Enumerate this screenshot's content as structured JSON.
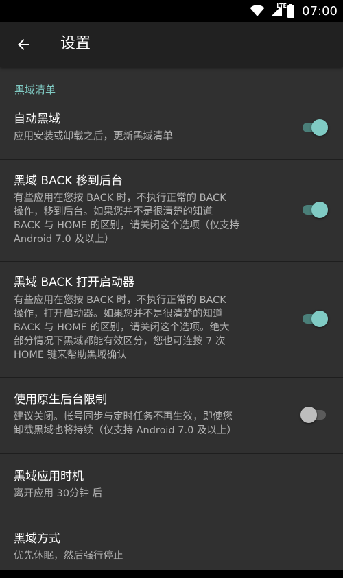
{
  "status_bar": {
    "time": "07:00",
    "network_label": "LTE"
  },
  "app_bar": {
    "title": "设置",
    "back_icon": "arrow-back-icon"
  },
  "section": {
    "header": "黑域清单"
  },
  "preferences": [
    {
      "title": "自动黑域",
      "summary": "应用安装或卸载之后，更新黑域清单",
      "switch": "on"
    },
    {
      "title": "黑域 BACK 移到后台",
      "summary": "有些应用在您按 BACK 时，不执行正常的 BACK\n操作，移到后台。如果您并不是很清楚的知道\nBACK 与 HOME 的区别，请关闭这个选项（仅支持\nAndroid 7.0 及以上）",
      "switch": "on"
    },
    {
      "title": "黑域 BACK 打开启动器",
      "summary": "有些应用在您按 BACK 时，不执行正常的 BACK\n操作，打开启动器。如果您并不是很清楚的知道\nBACK 与 HOME 的区别，请关闭这个选项。绝大\n部分情况下黑域都能有效区分，您也可连按 7 次\nHOME 键来帮助黑域确认",
      "switch": "on"
    },
    {
      "title": "使用原生后台限制",
      "summary": "建议关闭。帐号同步与定时任务不再生效，即使您\n卸载黑域也将持续（仅支持 Android 7.0 及以上）",
      "switch": "off"
    },
    {
      "title": "黑域应用时机",
      "summary": "离开应用 30分钟 后"
    },
    {
      "title": "黑域方式",
      "summary": "优先休眠，然后强行停止"
    }
  ],
  "colors": {
    "accent": "#80cbc4",
    "background": "#303030",
    "app_bar": "#212121",
    "status_bar": "#000000"
  }
}
